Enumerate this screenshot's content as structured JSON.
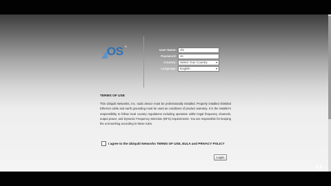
{
  "login": {
    "logo_text": "OS",
    "logo_tm": "®",
    "fields": [
      {
        "label": "User Name:",
        "value": "cfe",
        "type": "input"
      },
      {
        "label": "Password:",
        "value": "•••",
        "type": "input"
      },
      {
        "label": "Country:",
        "value": "Select Your Country",
        "type": "select"
      },
      {
        "label": "Language:",
        "value": "English",
        "type": "select"
      }
    ],
    "login_label": "Login"
  },
  "terms": {
    "title": "TERMS OF USE",
    "body": "This Ubiquiti Networks, Inc. radio device must be professionally installed. Properly installed shielded Ethernet cable and earth grounding must be used as conditions of product warranty. It is the installer's responsibility to follow local country regulations including operation within legal frequency channels, output power, and Dynamic Frequency Selection (DFS) requirements. You are responsible for keeping the unit working according to these rules.",
    "agree_text": "I agree to the Ubiquiti Networks TERMS OF USE, EULA and PRIVACY POLICY"
  },
  "icons": {
    "select_arrow": "▾",
    "play_pause": "❚❚",
    "fullscreen": "⛶"
  },
  "colors": {
    "logo_blue": "#2e6fb4"
  }
}
